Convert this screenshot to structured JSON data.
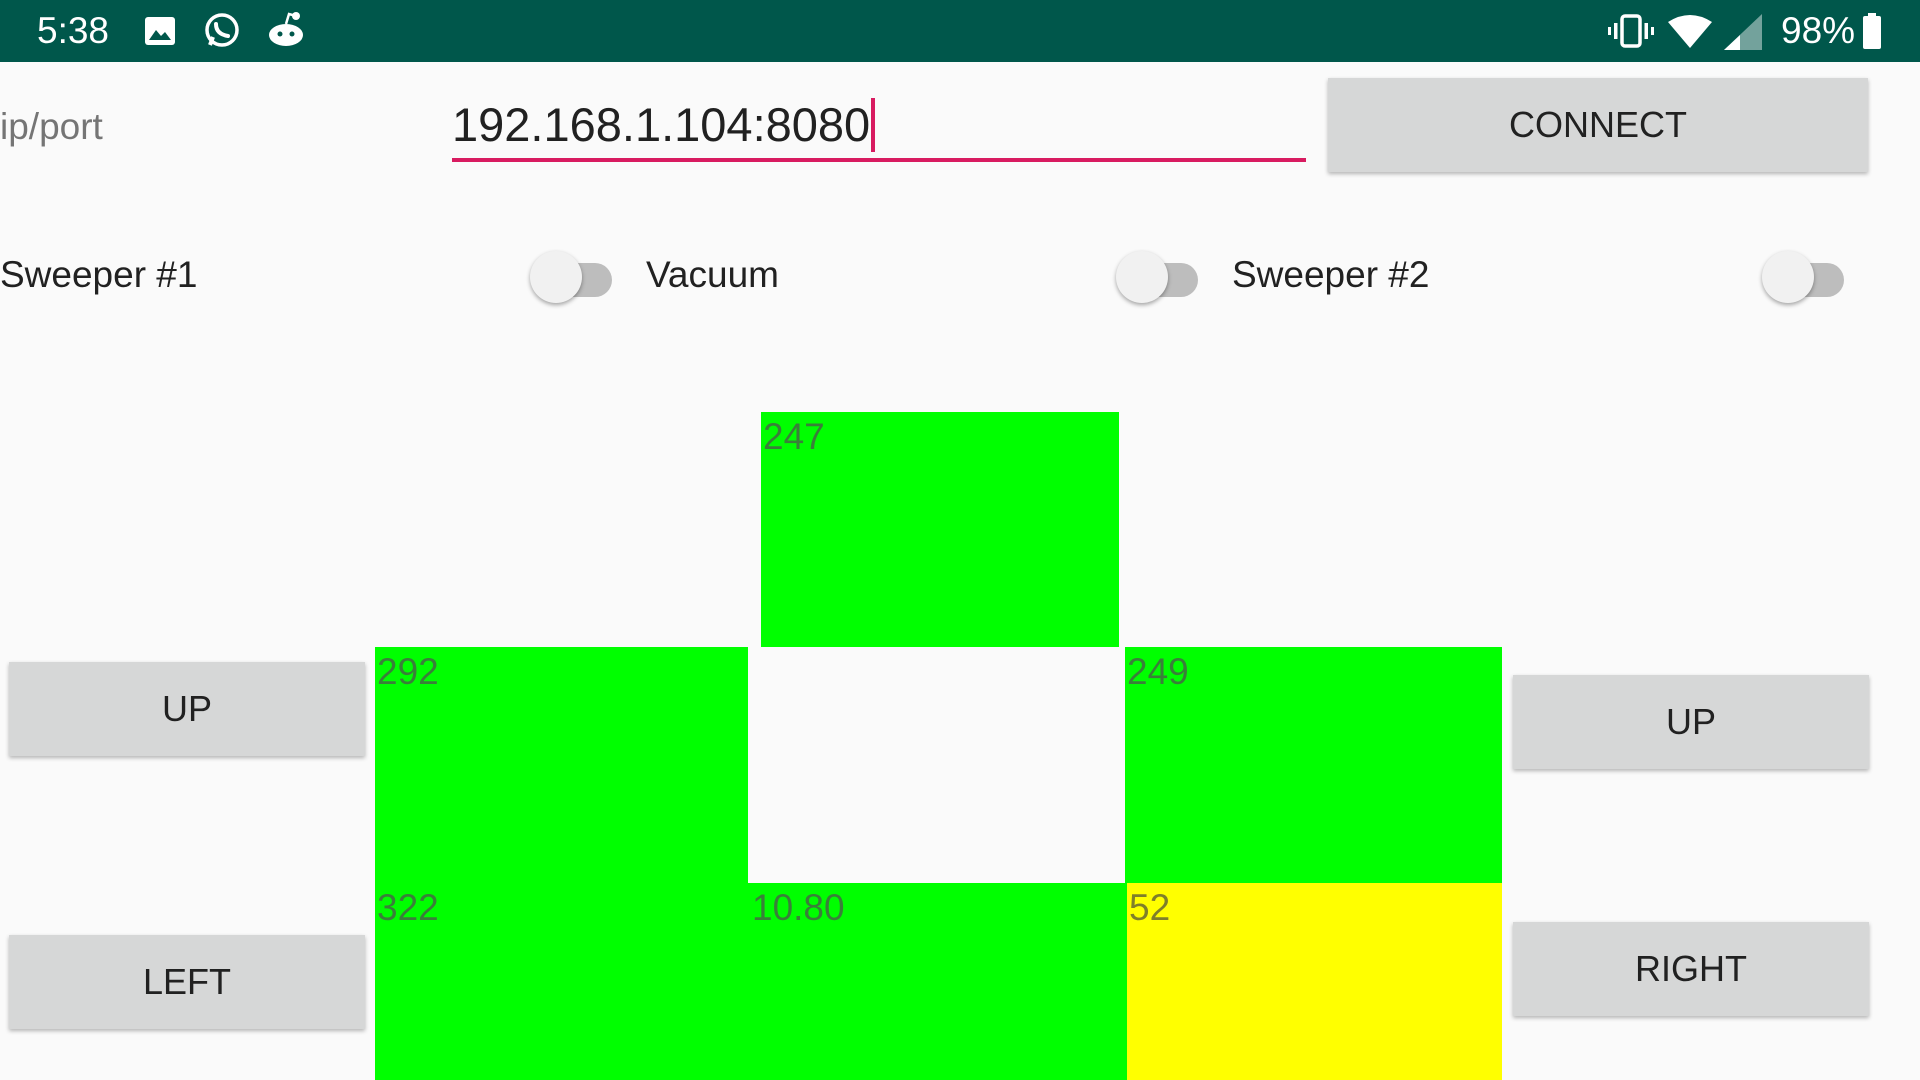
{
  "status_bar": {
    "time": "5:38",
    "battery": "98%",
    "icons": [
      "image-icon",
      "whatsapp-icon",
      "reddit-icon",
      "vibrate-icon",
      "wifi-icon",
      "cell-signal-icon",
      "battery-icon"
    ],
    "color": "#00574b"
  },
  "connection": {
    "label": "ip/port",
    "value": "192.168.1.104:8080",
    "connect_label": "CONNECT",
    "accent": "#d81b60"
  },
  "switches": [
    {
      "label": "Sweeper #1",
      "on": false
    },
    {
      "label": "Vacuum",
      "on": false
    },
    {
      "label": "Sweeper #2",
      "on": false
    }
  ],
  "controls": {
    "left_up": "UP",
    "left": "LEFT",
    "right_up": "UP",
    "right": "RIGHT"
  },
  "sensors": {
    "top": {
      "value": "247",
      "color": "#00ff00"
    },
    "mid_left": {
      "value": "292",
      "color": "#00ff00"
    },
    "mid_right": {
      "value": "249",
      "color": "#00ff00"
    },
    "bottom_left": {
      "value": "322",
      "color": "#00ff00"
    },
    "bottom_center": {
      "value": "10.80",
      "color": "#00ff00"
    },
    "bottom_right": {
      "value": "52",
      "color": "#ffff00"
    }
  }
}
